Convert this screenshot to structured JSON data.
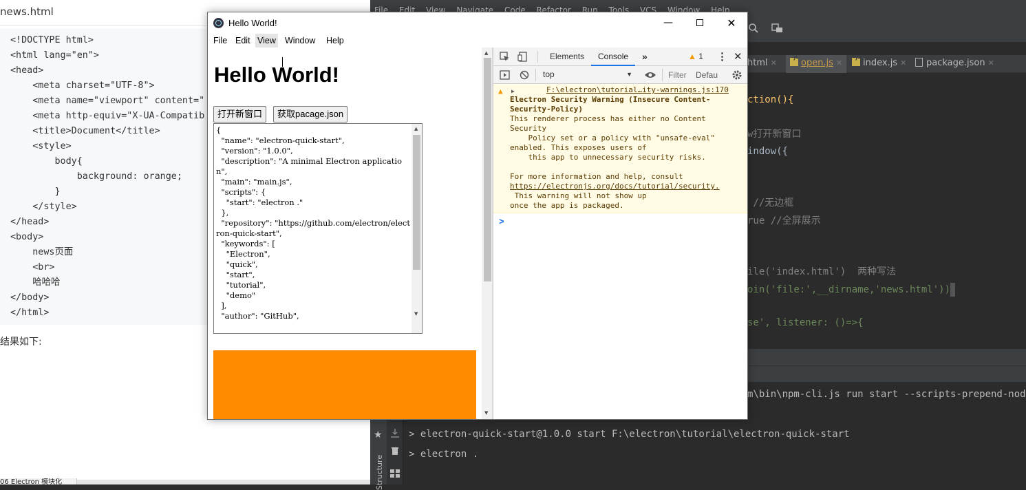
{
  "blog": {
    "title": "news.html",
    "code_lines": [
      "<!DOCTYPE html>",
      "<html lang=\"en\">",
      "<head>",
      "    <meta charset=\"UTF-8\">",
      "    <meta name=\"viewport\" content=\"",
      "    <meta http-equiv=\"X-UA-Compatib",
      "    <title>Document</title>",
      "    <style>",
      "        body{",
      "            background: orange;",
      "        }",
      "    </style>",
      "</head>",
      "<body>",
      "    news页面",
      "    <br>",
      "    哈哈哈",
      "</body>",
      "</html>"
    ],
    "result_text": "结果如下:",
    "bottom_tab": "06 Electron 模块化"
  },
  "ide": {
    "menu": [
      "File",
      "Edit",
      "View",
      "Navigate",
      "Code",
      "Refactor",
      "Run",
      "Tools",
      "VCS",
      "Window",
      "Help"
    ],
    "tabs": [
      {
        "label": "html",
        "active": false
      },
      {
        "label": "open.js",
        "active": true
      },
      {
        "label": "index.js",
        "active": false
      },
      {
        "label": "package.json",
        "active": false
      }
    ],
    "editor_lines": [
      "ction(){",
      "",
      "w打开新窗口",
      "indow({",
      "",
      "",
      " //无边框",
      "rue //全屏展示",
      "",
      "",
      "ile('index.html')  两种写法",
      "oin('file:',__dirname,'news.html'))",
      "",
      "se', listener: ()=>{"
    ],
    "hint_label": "listener:",
    "terminal_lines": [
      "m\\bin\\npm-cli.js run start --scripts-prepend-node-p",
      "> electron-quick-start@1.0.0 start F:\\electron\\tutorial\\electron-quick-start",
      "> electron ."
    ],
    "side_label": "Structure"
  },
  "electron": {
    "title": "Hello World!",
    "menu": [
      "File",
      "Edit",
      "View",
      "Window",
      "Help"
    ],
    "active_menu": "View",
    "heading": "Hello World!",
    "buttons": [
      "打开新窗口",
      "获取pacage.json"
    ],
    "json_text": "{\n  \"name\": \"electron-quick-start\",\n  \"version\": \"1.0.0\",\n  \"description\": \"A minimal Electron application\",\n  \"main\": \"main.js\",\n  \"scripts\": {\n    \"start\": \"electron .\"\n  },\n  \"repository\": \"https://github.com/electron/electron-quick-start\",\n  \"keywords\": [\n    \"Electron\",\n    \"quick\",\n    \"start\",\n    \"tutorial\",\n    \"demo\"\n  ],\n  \"author\": \"GitHub\","
  },
  "devtools": {
    "tabs": [
      "Elements",
      "Console"
    ],
    "active_tab": "Console",
    "warning_count": "1",
    "context": "top",
    "filter_placeholder": "Filter",
    "levels": "Defau",
    "warning": {
      "source": "F:\\electron\\tutorial…ity-warnings.js:170",
      "lines": [
        "Electron Security Warning (Insecure Content-",
        "Security-Policy)",
        "This renderer process has either no Content",
        "Security",
        "    Policy set or a policy with \"unsafe-eval\"",
        "enabled. This exposes users of",
        "    this app to unnecessary security risks.",
        "",
        "For more information and help, consult",
        "https://electronjs.org/docs/tutorial/security.",
        " This warning will not show up",
        "once the app is packaged."
      ]
    },
    "prompt": ">"
  },
  "colors": {
    "orange": "#ff8c00",
    "ide_bg": "#2b2b2b",
    "warning_bg": "#fffbe5",
    "active_tab": "#1a73e8"
  }
}
